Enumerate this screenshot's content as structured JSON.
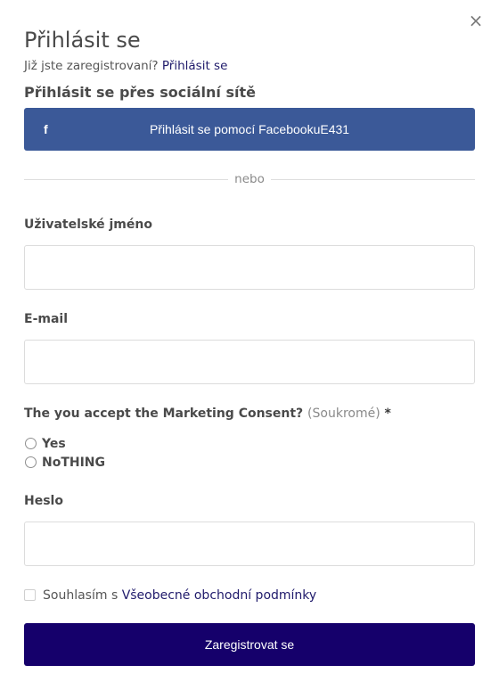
{
  "dialog": {
    "close_symbol": "×",
    "title": "Přihlásit se",
    "already_registered_text": "Již jste zaregistrovaní? ",
    "login_link": "Přihlásit se"
  },
  "social": {
    "heading": "Přihlásit se přes sociální sítě",
    "facebook_icon": "f",
    "facebook_button_label": "Přihlásit se pomocí FacebookuE431",
    "brand_color": "#3b5998"
  },
  "divider": {
    "text": "nebo"
  },
  "form": {
    "username_label": "Uživatelské jméno",
    "username_value": "",
    "email_label": "E-mail",
    "email_value": "",
    "consent": {
      "label": "The you accept the Marketing Consent?",
      "visibility": "(Soukromé)",
      "required_mark": "*",
      "options": [
        "Yes",
        "NoTHING"
      ]
    },
    "password_label": "Heslo",
    "password_value": "",
    "terms_prefix": "Souhlasím s ",
    "terms_link": "Všeobecné obchodní podmínky",
    "submit_label": "Zaregistrovat se",
    "submit_color": "#15006b",
    "link_color": "#1f1a6b"
  }
}
